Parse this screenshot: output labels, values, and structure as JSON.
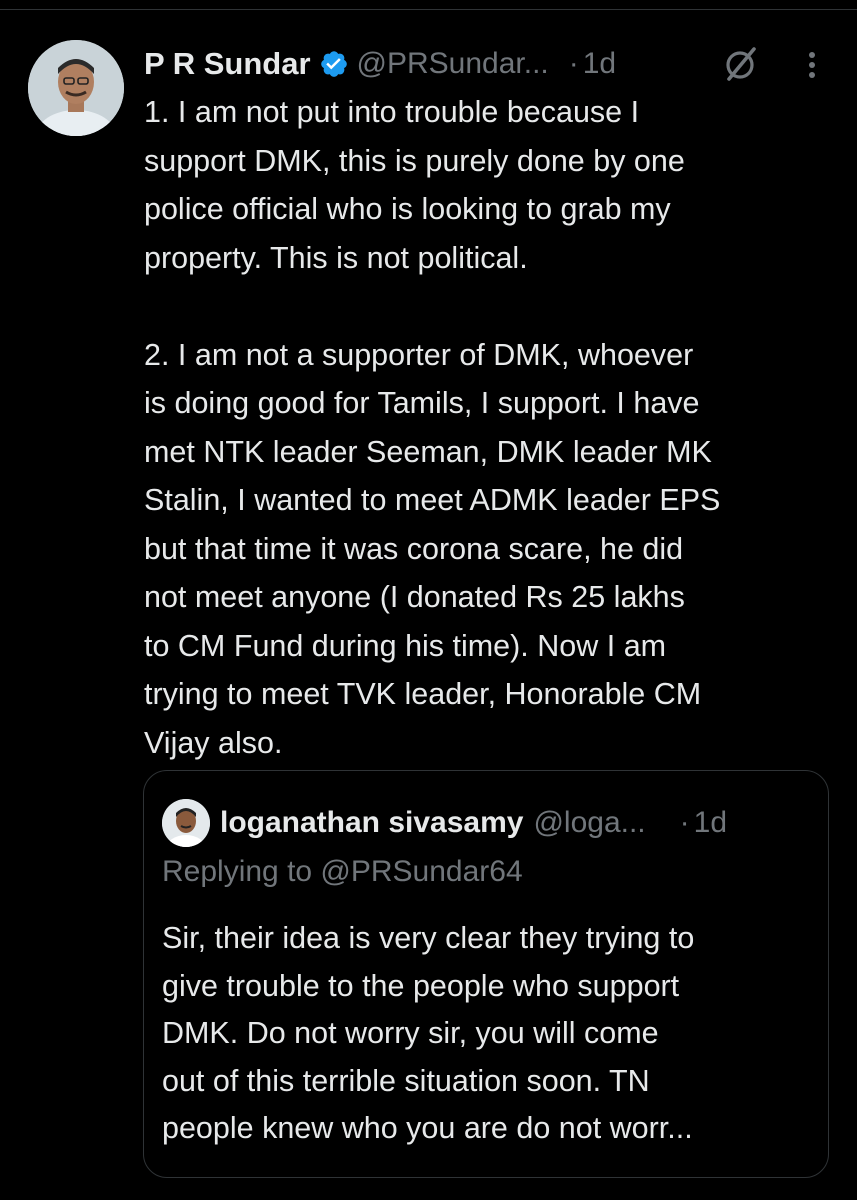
{
  "tweet": {
    "author_name": "P R Sundar",
    "handle": "@PRSundar...",
    "separator": "·",
    "time": "1d",
    "verified": true,
    "text": "1. I am not put into trouble because I\nsupport DMK, this is purely done by one\npolice official who is looking to grab my\nproperty. This is not political.\n\n2. I am not a supporter of DMK, whoever\nis doing good for Tamils, I support. I have\nmet NTK leader Seeman, DMK leader MK\nStalin, I wanted to meet ADMK leader EPS\nbut that time it was corona scare, he did\nnot meet anyone (I donated Rs 25 lakhs\nto CM Fund during his time). Now I am\ntrying to meet TVK leader, Honorable CM\nVijay also.",
    "icons": {
      "verified": "verified-badge-icon",
      "grok": "grok-icon",
      "more": "more-vertical-icon"
    }
  },
  "quoted_tweet": {
    "author_name": "loganathan sivasamy",
    "handle": "@loga...",
    "separator": "·",
    "time": "1d",
    "replying_to": "Replying to @PRSundar64",
    "text": "Sir, their idea is very clear they trying to\ngive trouble to the people who support\nDMK. Do not worry sir, you will come\nout of this terrible situation soon. TN\npeople knew who you are do not worr..."
  },
  "colors": {
    "background": "#000000",
    "primary_text": "#e7e9ea",
    "secondary_text": "#71767b",
    "border": "#2f3336",
    "verified_blue": "#1d9bf0"
  }
}
